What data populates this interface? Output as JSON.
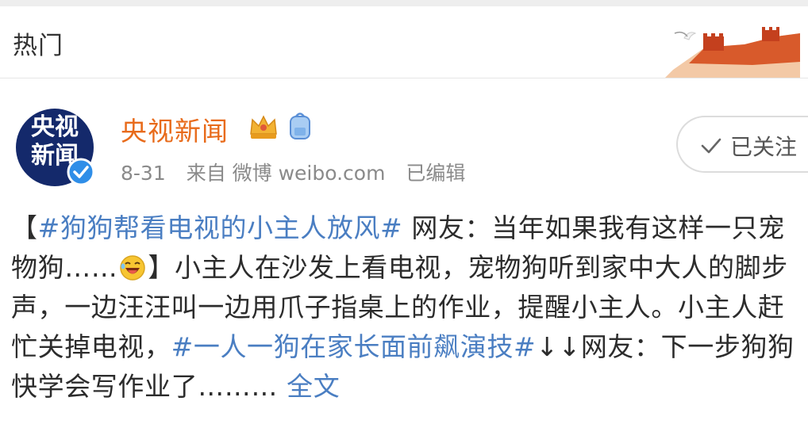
{
  "header": {
    "title": "热门"
  },
  "post": {
    "author": {
      "name": "央视新闻",
      "avatar_line1": "央视",
      "avatar_line2": "新闻"
    },
    "meta": {
      "date": "8-31",
      "source": "来自 微博 weibo.com",
      "edited": "已编辑"
    },
    "follow_button": {
      "label": "已关注"
    },
    "body": {
      "open_bracket": "【",
      "hashtag1": "#狗狗帮看电视的小主人放风#",
      "headline": " 网友：当年如果我有这样一只宠物狗……",
      "close_bracket": "】",
      "paragraph": "小主人在沙发上看电视，宠物狗听到家中大人的脚步声，一边汪汪叫一边用爪子指桌上的作业，提醒小主人。小主人赶忙关掉电视，",
      "hashtag2": "#一人一狗在家长面前飙演技#",
      "arrows": "↓↓",
      "ending": "网友：下一步狗狗快学会写作业了………",
      "full_text_link": " 全文"
    }
  },
  "colors": {
    "author_name": "#e86b1b",
    "hashtag": "#4a7ec2",
    "avatar_bg": "#14296b",
    "verified_badge": "#2f8ee8"
  },
  "icons": {
    "crown": "crown-vip-icon",
    "backpack": "backpack-icon",
    "verified": "verified-badge-icon",
    "check": "check-icon",
    "emoji": "laughing-emoji-icon",
    "decoration": "great-wall-decoration"
  }
}
